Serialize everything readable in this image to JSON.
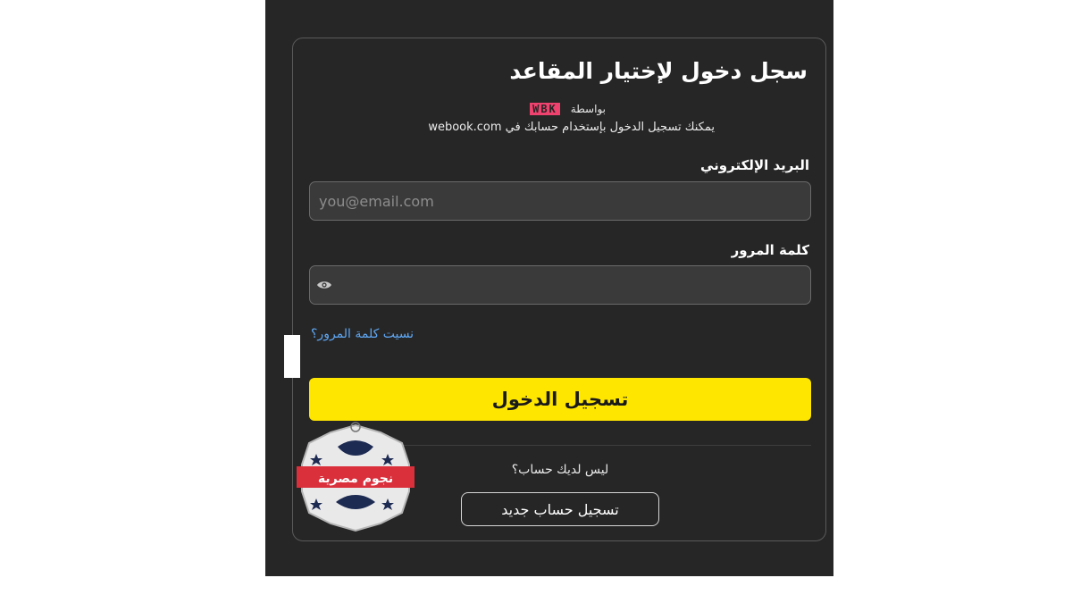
{
  "login": {
    "title": "سجل دخول لإختيار المقاعد",
    "by_label": "بواسطة",
    "brand_logo_text": "WBK",
    "subtitle": "يمكنك تسجيل الدخول بإستخدام حسابك في webook.com",
    "email_label": "البريد الإلكتروني",
    "email_placeholder": "you@email.com",
    "password_label": "كلمة المرور",
    "forgot_password": "نسيت كلمة المرور؟",
    "login_button": "تسجيل الدخول",
    "no_account_text": "ليس لديك حساب؟",
    "register_button": "تسجيل حساب جديد"
  },
  "watermark": {
    "text": "نجوم مصرية"
  },
  "colors": {
    "panel_bg": "#262626",
    "input_bg": "#3a3a3a",
    "primary_button": "#ffe600",
    "link": "#5fa8f5",
    "brand_pink": "#f0426e"
  },
  "icons": {
    "password_toggle": "eye-icon"
  }
}
